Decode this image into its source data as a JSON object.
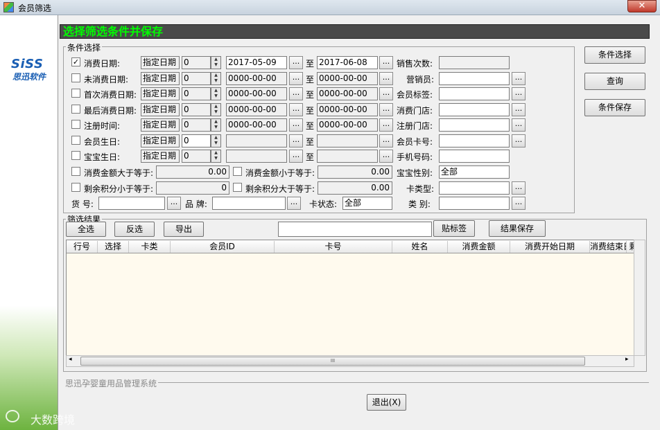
{
  "window": {
    "title": "会员筛选",
    "close_label": "✕"
  },
  "logo": {
    "mark": "SiSS",
    "text": "思迅软件"
  },
  "watermark": {
    "text": "大数跨境"
  },
  "banner": {
    "title": "选择筛选条件并保存"
  },
  "conditions": {
    "legend": "条件选择",
    "date_rows": [
      {
        "checked": true,
        "label": "消费日期:",
        "mode": "指定日期",
        "offset": "0",
        "from": "2017-05-09",
        "to_label": "至",
        "to": "2017-06-08"
      },
      {
        "checked": false,
        "label": "未消费日期:",
        "mode": "指定日期",
        "offset": "0",
        "from": "0000-00-00",
        "to_label": "至",
        "to": "0000-00-00"
      },
      {
        "checked": false,
        "label": "首次消费日期:",
        "mode": "指定日期",
        "offset": "0",
        "from": "0000-00-00",
        "to_label": "至",
        "to": "0000-00-00"
      },
      {
        "checked": false,
        "label": "最后消费日期:",
        "mode": "指定日期",
        "offset": "0",
        "from": "0000-00-00",
        "to_label": "至",
        "to": "0000-00-00"
      },
      {
        "checked": false,
        "label": "注册时间:",
        "mode": "指定日期",
        "offset": "0",
        "from": "0000-00-00",
        "to_label": "至",
        "to": "0000-00-00"
      },
      {
        "checked": false,
        "label": "会员生日:",
        "mode": "指定日期",
        "offset": "0",
        "from": "",
        "to_label": "至",
        "to": ""
      },
      {
        "checked": false,
        "label": "宝宝生日:",
        "mode": "指定日期",
        "offset": "0",
        "from": "",
        "to_label": "至",
        "to": ""
      }
    ],
    "right_fields": [
      {
        "label": "销售次数:",
        "value": ""
      },
      {
        "label": "营销员:",
        "value": ""
      },
      {
        "label": "会员标签:",
        "value": ""
      },
      {
        "label": "消费门店:",
        "value": ""
      },
      {
        "label": "注册门店:",
        "value": ""
      },
      {
        "label": "会员卡号:",
        "value": ""
      },
      {
        "label": "手机号码:",
        "value": ""
      },
      {
        "label": "宝宝性别:",
        "value": "全部"
      },
      {
        "label": "卡类型:",
        "value": ""
      },
      {
        "label": "类  别:",
        "value": ""
      }
    ],
    "amount_rows": [
      {
        "label1": "消费金额大于等于:",
        "value1": "0.00",
        "label2": "消费金额小于等于:",
        "value2": "0.00"
      },
      {
        "label1": "剩余积分小于等于:",
        "value1": "0",
        "label2": "剩余积分大于等于:",
        "value2": "0.00"
      }
    ],
    "bottom_row": {
      "item_label": "货  号:",
      "item_value": "",
      "brand_label": "品  牌:",
      "brand_value": "",
      "status_label": "卡状态:",
      "status_value": "全部"
    },
    "dots_label": "..."
  },
  "side_buttons": {
    "select": "条件选择",
    "query": "查询",
    "save": "条件保存"
  },
  "results": {
    "legend": "筛选结果",
    "select_all": "全选",
    "invert": "反选",
    "export": "导出",
    "tag_input": "",
    "tag_button": "贴标签",
    "save_button": "结果保存",
    "columns": [
      "行号",
      "选择",
      "卡类",
      "会员ID",
      "卡号",
      "姓名",
      "消费金额",
      "消费开始日期",
      "消费结束日期",
      "剩"
    ],
    "scroll_left": "◂",
    "scroll_right": "▸",
    "scroll_grip": "III"
  },
  "footer": {
    "system_name": "思迅孕婴童用品管理系统",
    "exit_button": "退出(X)"
  }
}
